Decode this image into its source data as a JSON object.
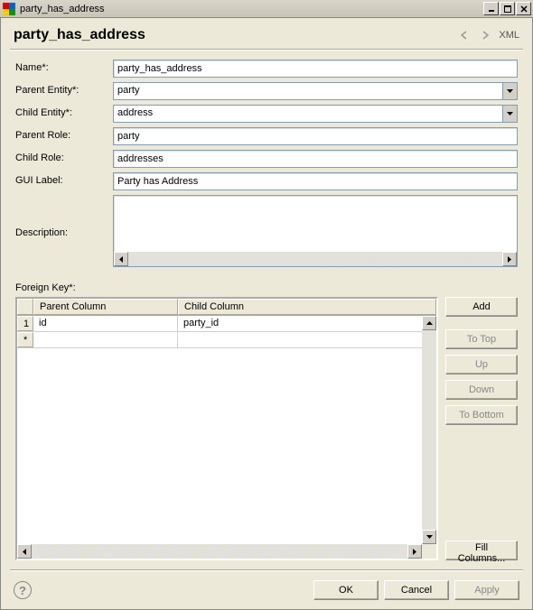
{
  "window": {
    "title": "party_has_address"
  },
  "header": {
    "title": "party_has_address",
    "xml_label": "XML"
  },
  "form": {
    "name": {
      "label": "Name*:",
      "value": "party_has_address"
    },
    "parent_entity": {
      "label": "Parent Entity*:",
      "value": "party"
    },
    "child_entity": {
      "label": "Child Entity*:",
      "value": "address"
    },
    "parent_role": {
      "label": "Parent Role:",
      "value": "party"
    },
    "child_role": {
      "label": "Child Role:",
      "value": "addresses"
    },
    "gui_label": {
      "label": "GUI Label:",
      "value": "Party has Address"
    },
    "description": {
      "label": "Description:",
      "value": ""
    }
  },
  "foreign_key": {
    "label": "Foreign Key*:",
    "columns": {
      "parent": "Parent Column",
      "child": "Child Column"
    },
    "rows": [
      {
        "num": "1",
        "parent": "id",
        "child": "party_id"
      },
      {
        "num": "*",
        "parent": "",
        "child": ""
      }
    ]
  },
  "buttons": {
    "add": "Add",
    "to_top": "To Top",
    "up": "Up",
    "down": "Down",
    "to_bottom": "To Bottom",
    "fill_columns": "Fill Columns..."
  },
  "footer": {
    "ok": "OK",
    "cancel": "Cancel",
    "apply": "Apply"
  }
}
